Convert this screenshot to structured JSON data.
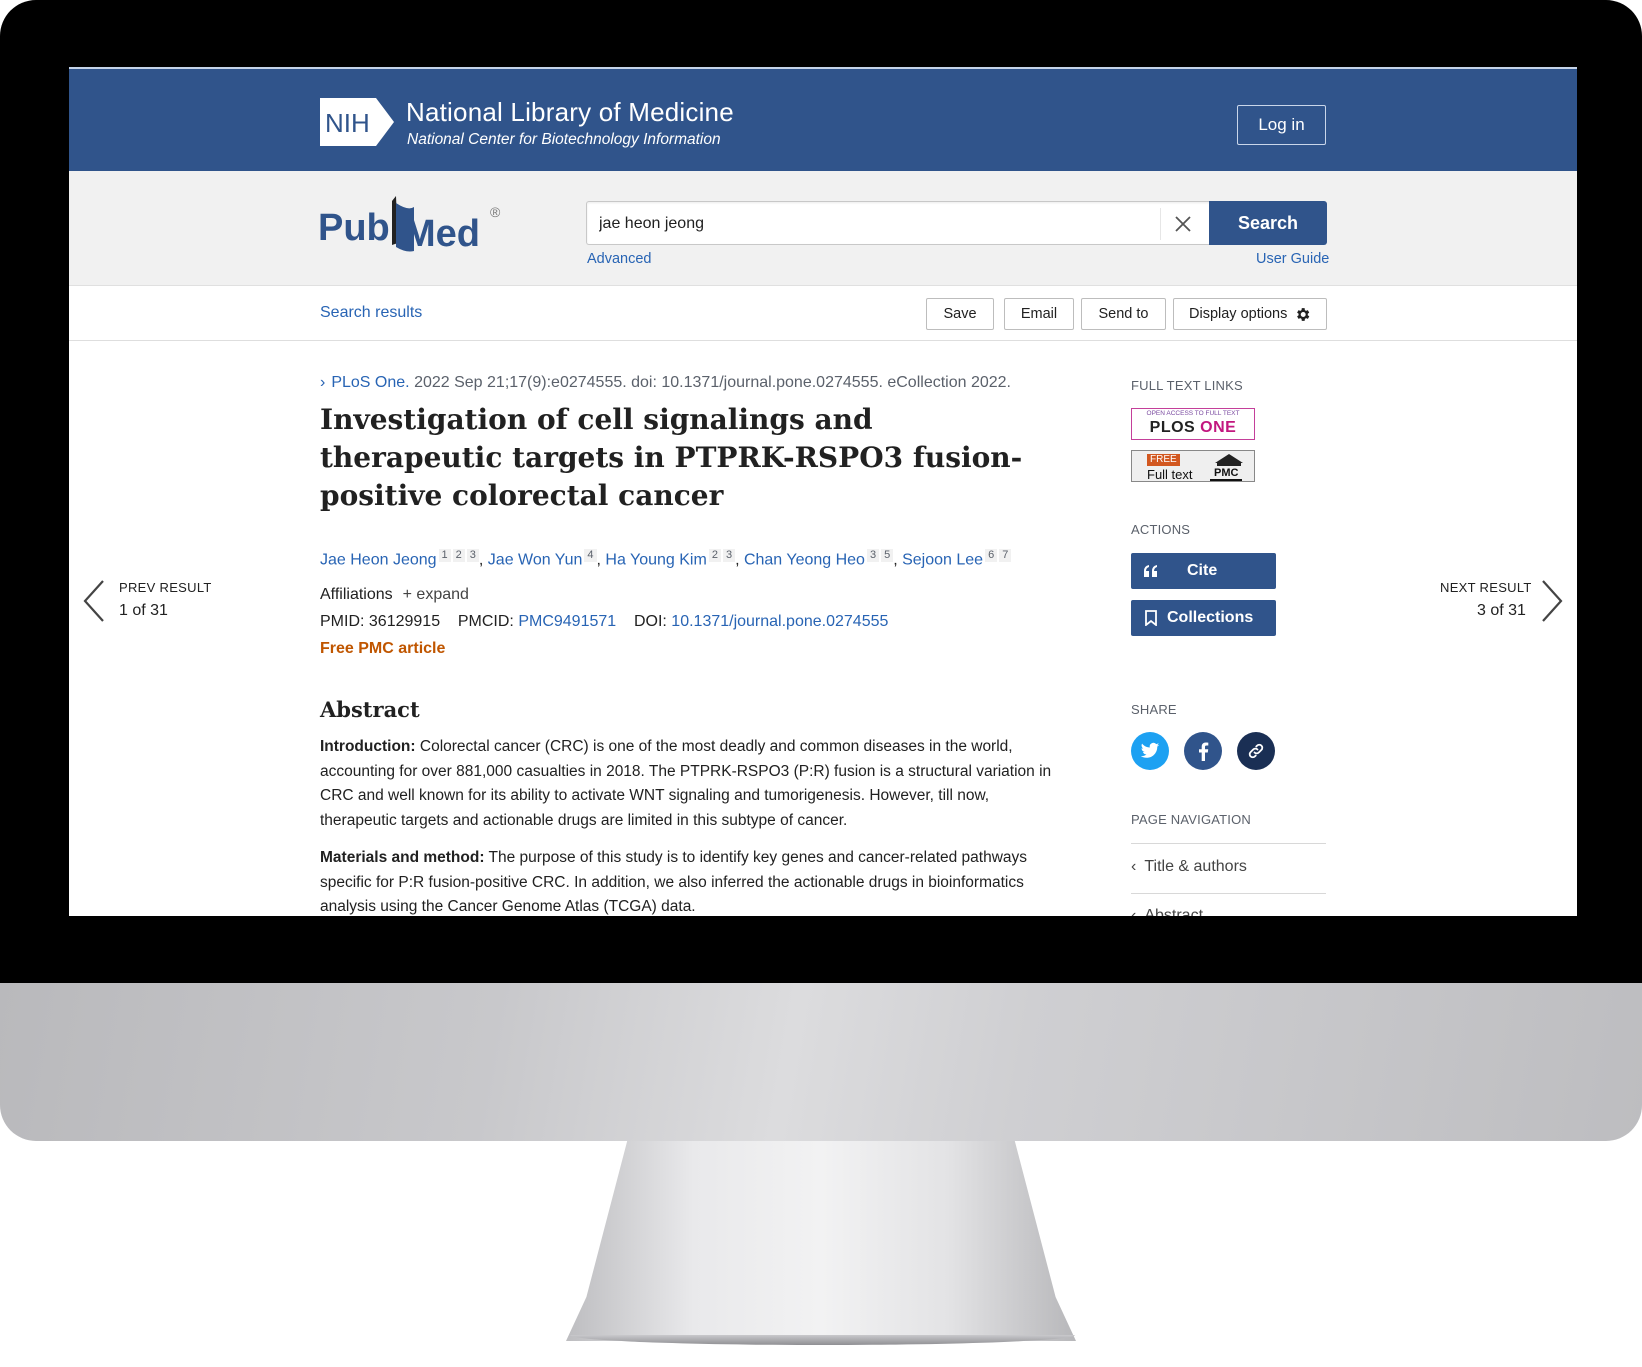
{
  "header": {
    "nih_logo_text": "NIH",
    "title": "National Library of Medicine",
    "subtitle": "National Center for Biotechnology Information",
    "login_label": "Log in"
  },
  "search": {
    "logo_text_pub": "Pub",
    "logo_text_med": "Med",
    "logo_mark": "®",
    "query": "jae heon jeong",
    "button_label": "Search",
    "advanced_label": "Advanced",
    "user_guide_label": "User Guide"
  },
  "toolbar": {
    "search_results_label": "Search results",
    "save_label": "Save",
    "email_label": "Email",
    "send_to_label": "Send to",
    "display_options_label": "Display options"
  },
  "article": {
    "journal": "PLoS One.",
    "citation": "2022 Sep 21;17(9):e0274555. doi: 10.1371/journal.pone.0274555. eCollection 2022.",
    "title": "Investigation of cell signalings and therapeutic targets in PTPRK-RSPO3 fusion-positive colorectal cancer",
    "authors": [
      {
        "name": "Jae Heon Jeong",
        "affs": [
          "1",
          "2",
          "3"
        ]
      },
      {
        "name": "Jae Won Yun",
        "affs": [
          "4"
        ]
      },
      {
        "name": "Ha Young Kim",
        "affs": [
          "2",
          "3"
        ]
      },
      {
        "name": "Chan Yeong Heo",
        "affs": [
          "3",
          "5"
        ]
      },
      {
        "name": "Sejoon Lee",
        "affs": [
          "6",
          "7"
        ]
      }
    ],
    "affiliations_label": "Affiliations",
    "expand_label": "+ expand",
    "pmid_label": "PMID:",
    "pmid": "36129915",
    "pmcid_label": "PMCID:",
    "pmcid": "PMC9491571",
    "doi_label": "DOI:",
    "doi": "10.1371/journal.pone.0274555",
    "free_pmc_label": "Free PMC article",
    "abstract_heading": "Abstract",
    "intro_label": "Introduction:",
    "intro_text": "Colorectal cancer (CRC) is one of the most deadly and common diseases in the world, accounting for over 881,000 casualties in 2018. The PTPRK-RSPO3 (P:R) fusion is a structural variation in CRC and well known for its ability to activate WNT signaling and tumorigenesis. However, till now, therapeutic targets and actionable drugs are limited in this subtype of cancer.",
    "methods_label": "Materials and method:",
    "methods_text": "The purpose of this study is to identify key genes and cancer-related pathways specific for P:R fusion-positive CRC. In addition, we also inferred the actionable drugs in bioinformatics analysis using the Cancer Genome Atlas (TCGA) data."
  },
  "navigation": {
    "prev_label": "PREV RESULT",
    "prev_count": "1 of 31",
    "next_label": "NEXT RESULT",
    "next_count": "3 of 31"
  },
  "sidebar": {
    "full_text_heading": "FULL TEXT LINKS",
    "plos_badge_top": "OPEN ACCESS TO FULL TEXT",
    "plos_badge_plos": "PLOS",
    "plos_badge_one": "ONE",
    "pmc_free": "FREE",
    "pmc_fulltext": "Full text",
    "pmc_label": "PMC",
    "actions_heading": "ACTIONS",
    "cite_label": "Cite",
    "collections_label": "Collections",
    "share_heading": "SHARE",
    "page_nav_heading": "PAGE NAVIGATION",
    "page_nav_items": [
      "Title & authors",
      "Abstract"
    ]
  },
  "colors": {
    "brand_blue": "#30548b",
    "link_blue": "#2864b4",
    "free_orange": "#c05600",
    "twitter": "#1da1f2",
    "facebook": "#3b5998",
    "permalink": "#1a2f54"
  }
}
